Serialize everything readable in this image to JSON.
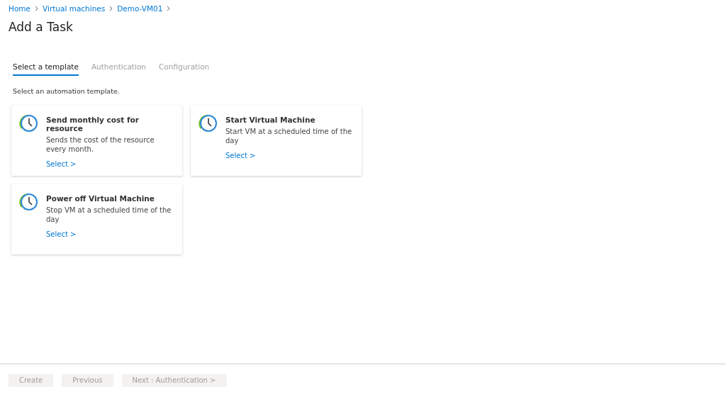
{
  "breadcrumb": [
    {
      "label": "Home"
    },
    {
      "label": "Virtual machines"
    },
    {
      "label": "Demo-VM01"
    }
  ],
  "title": "Add a Task",
  "tabs": [
    {
      "label": "Select a template",
      "selected": true
    },
    {
      "label": "Authentication",
      "selected": false
    },
    {
      "label": "Configuration",
      "selected": false
    }
  ],
  "instruction": "Select an automation template.",
  "templates": [
    {
      "title": "Send monthly cost for resource",
      "description": "Sends the cost of the resource every month.",
      "link": "Select >"
    },
    {
      "title": "Start Virtual Machine",
      "description": "Start VM at a scheduled time of the day",
      "link": "Select >"
    },
    {
      "title": "Power off Virtual Machine",
      "description": "Stop VM at a scheduled time of the day",
      "link": "Select >"
    }
  ],
  "footer_buttons": [
    {
      "label": "Create",
      "disabled": true
    },
    {
      "label": "Previous",
      "disabled": true
    },
    {
      "label": "Next : Authentication >",
      "disabled": true
    }
  ]
}
